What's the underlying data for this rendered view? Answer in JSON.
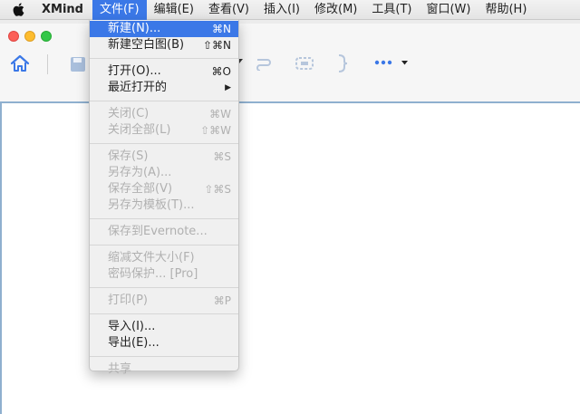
{
  "menubar": {
    "app_name": "XMind",
    "menus": [
      {
        "label": "文件(F)"
      },
      {
        "label": "编辑(E)"
      },
      {
        "label": "查看(V)"
      },
      {
        "label": "插入(I)"
      },
      {
        "label": "修改(M)"
      },
      {
        "label": "工具(T)"
      },
      {
        "label": "窗口(W)"
      },
      {
        "label": "帮助(H)"
      }
    ],
    "active_menu": "文件(F)"
  },
  "file_menu": {
    "items": [
      {
        "label": "新建(N)...",
        "shortcut": "⌘N"
      },
      {
        "label": "新建空白图(B)",
        "shortcut": "⇧⌘N"
      },
      {
        "label": "打开(O)...",
        "shortcut": "⌘O"
      },
      {
        "label": "最近打开的",
        "shortcut": "▶"
      },
      {
        "label": "关闭(C)",
        "shortcut": "⌘W"
      },
      {
        "label": "关闭全部(L)",
        "shortcut": "⇧⌘W"
      },
      {
        "label": "保存(S)",
        "shortcut": "⌘S"
      },
      {
        "label": "另存为(A)...",
        "shortcut": ""
      },
      {
        "label": "保存全部(V)",
        "shortcut": "⇧⌘S"
      },
      {
        "label": "另存为模板(T)...",
        "shortcut": ""
      },
      {
        "label": "保存到Evernote...",
        "shortcut": ""
      },
      {
        "label": "缩减文件大小(F)",
        "shortcut": ""
      },
      {
        "label": "密码保护... [Pro]",
        "shortcut": ""
      },
      {
        "label": "打印(P)",
        "shortcut": "⌘P"
      },
      {
        "label": "导入(I)...",
        "shortcut": ""
      },
      {
        "label": "导出(E)...",
        "shortcut": ""
      },
      {
        "label": "共享",
        "shortcut": ""
      }
    ]
  },
  "toolbar": {
    "icons": [
      "home-icon",
      "save-icon",
      "dropdown-arrow-icon",
      "relationship-icon",
      "boundary-icon",
      "summary-icon",
      "more-icon",
      "chevron-down-icon"
    ]
  },
  "colors": {
    "accent": "#3b78e7",
    "disabled_text": "#b0b0b0",
    "canvas_border": "#8fb0cf"
  }
}
